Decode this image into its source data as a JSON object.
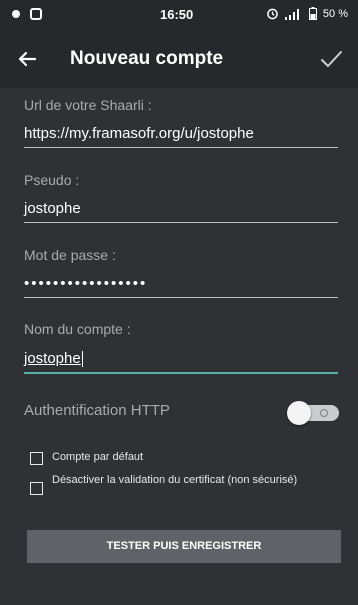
{
  "status_bar": {
    "time": "16:50",
    "battery": "50 %",
    "icons": [
      "notification-icon",
      "app-icon",
      "alarm-icon",
      "signal-icon",
      "battery-icon"
    ]
  },
  "toolbar": {
    "title": "Nouveau compte",
    "back_icon": "arrow-left-icon",
    "save_icon": "check-icon"
  },
  "form": {
    "url_label": "Url de votre Shaarli :",
    "url_value": "https://my.framasofr.org/u/jostophe",
    "pseudo_label": "Pseudo :",
    "pseudo_value": "jostophe",
    "password_label": "Mot de passe :",
    "password_value": "•••••••••••••••••",
    "account_label": "Nom du compte :",
    "account_value": "jostophe",
    "http_auth_label": "Authentification HTTP",
    "http_auth_enabled": false,
    "default_account_label": "Compte par défaut",
    "disable_cert_label": "Désactiver la validation du certificat (non sécurisé)",
    "submit_label": "TESTER PUIS ENREGISTRER"
  },
  "colors": {
    "background": "#2f3135",
    "toolbar": "#26282b",
    "accent": "#56b1a6",
    "button": "#5f6266"
  }
}
